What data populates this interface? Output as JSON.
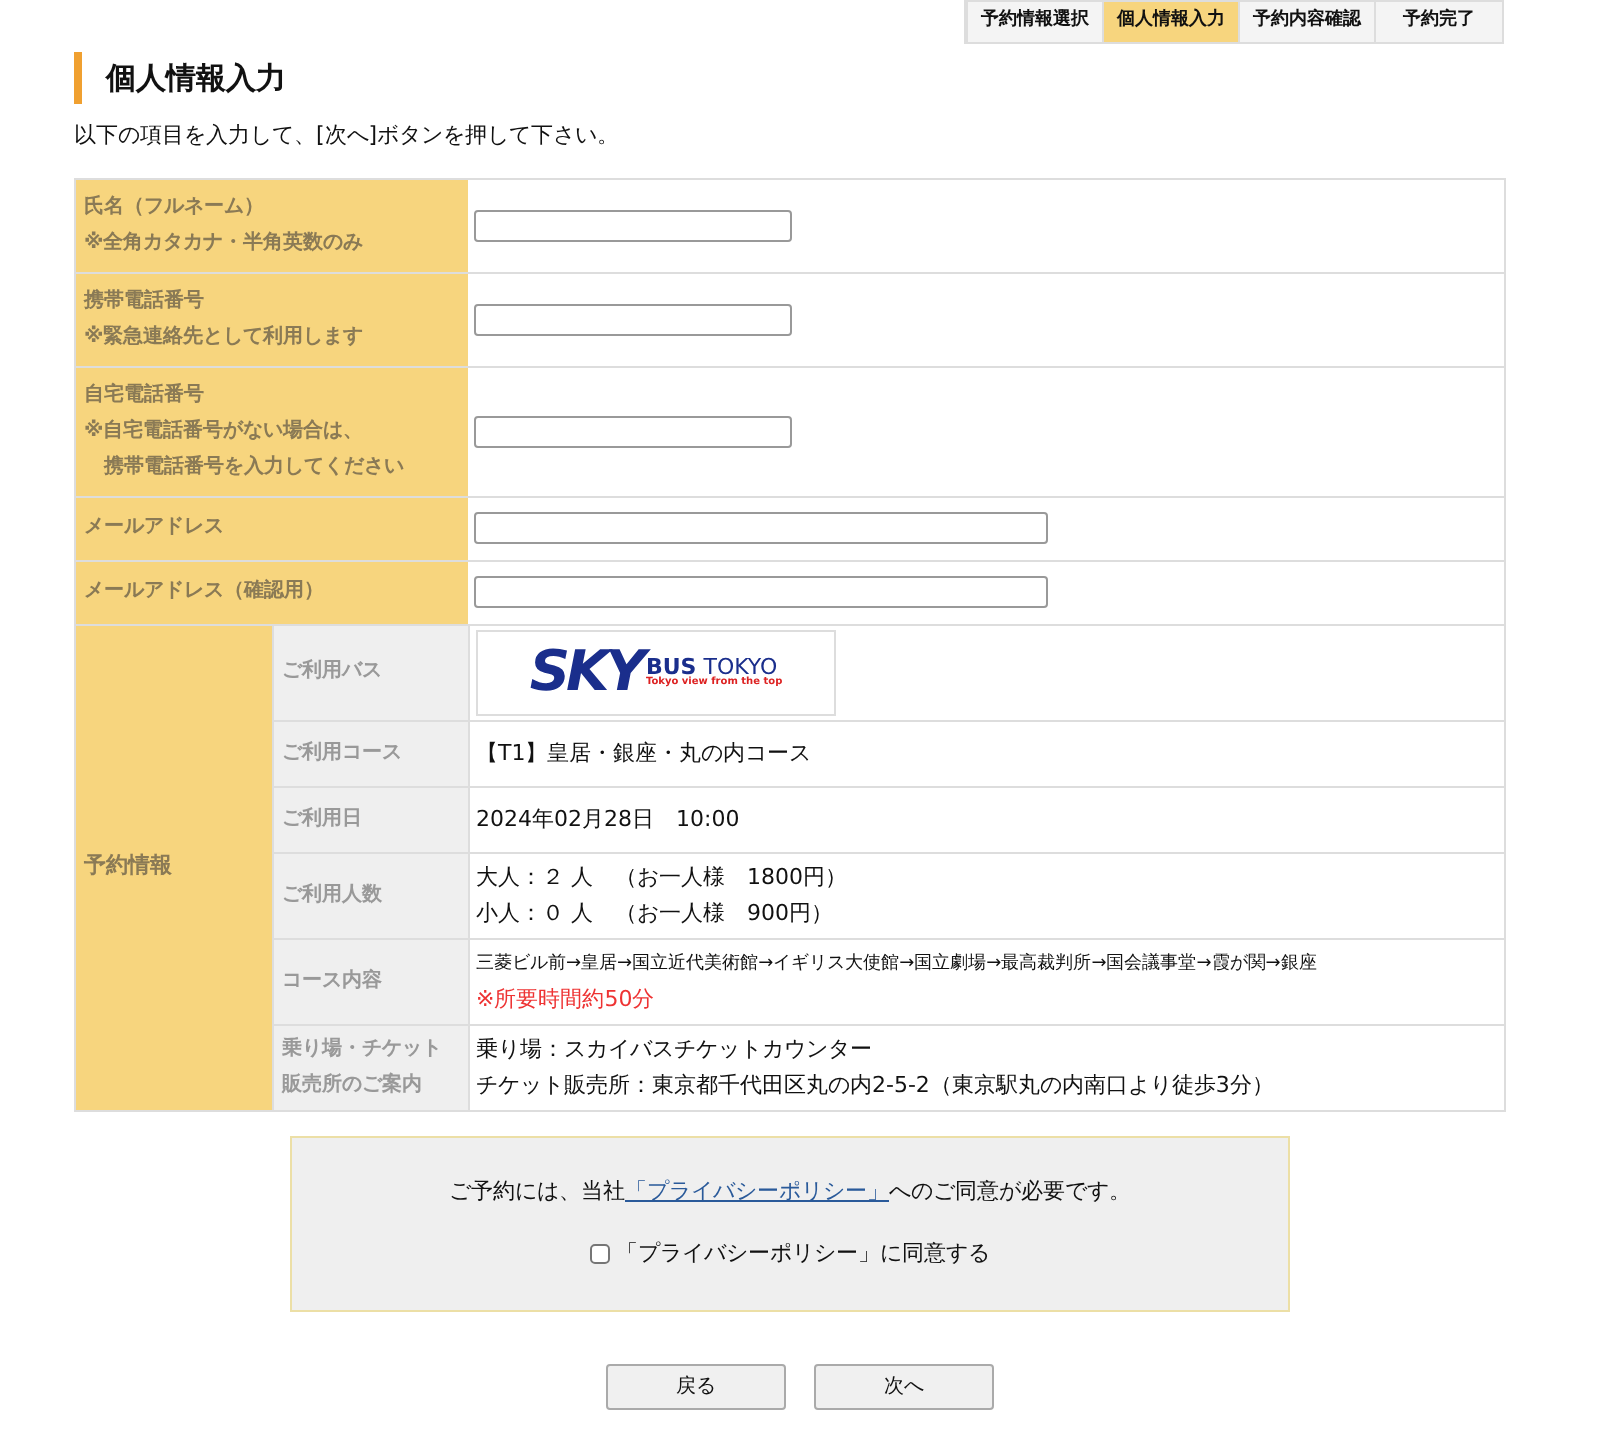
{
  "steps": [
    {
      "label": "予約情報選択",
      "selected": false
    },
    {
      "label": "個人情報入力",
      "selected": true
    },
    {
      "label": "予約内容確認",
      "selected": false
    },
    {
      "label": "予約完了",
      "selected": false
    }
  ],
  "title": "個人情報入力",
  "instruction": "以下の項目を入力して、[次へ]ボタンを押して下さい。",
  "fields": [
    {
      "label": "氏名（フルネーム）",
      "notes": [
        "※全角カタカナ・半角英数のみ"
      ],
      "kind": "short"
    },
    {
      "label": "携帯電話番号",
      "notes": [
        "※緊急連絡先として利用します"
      ],
      "kind": "short"
    },
    {
      "label": "自宅電話番号",
      "notes": [
        "※自宅電話番号がない場合は、",
        "　携帯電話番号を入力してください"
      ],
      "kind": "short"
    },
    {
      "label": "メールアドレス",
      "kind": "long"
    },
    {
      "label": "メールアドレス（確認用）",
      "kind": "long"
    }
  ],
  "reservation": {
    "label": "予約情報",
    "rows": [
      {
        "label": "ご利用バス",
        "kind": "logo",
        "logo": {
          "mark": "SKY",
          "name": "BUS TOKYO",
          "tagline": "Tokyo view from the top"
        }
      },
      {
        "label": "ご利用コース",
        "kind": "text",
        "lines": [
          "【T1】皇居・銀座・丸の内コース"
        ]
      },
      {
        "label": "ご利用日",
        "kind": "text",
        "lines": [
          "2024年02月28日　10:00"
        ]
      },
      {
        "label": "ご利用人数",
        "kind": "text",
        "lines": [
          "大人：２ 人　（お一人様　1800円）",
          "小人：０ 人　（お一人様　900円）"
        ]
      },
      {
        "label": "コース内容",
        "kind": "route",
        "lines": [
          "三菱ビル前→皇居→国立近代美術館→イギリス大使館→国立劇場→最高裁判所→国会議事堂→霞が関→銀座"
        ],
        "warning": "※所要時間約50分"
      },
      {
        "label": "乗り場・チケット販売所のご案内",
        "kind": "text",
        "lines": [
          "乗り場：スカイバスチケットカウンター",
          "チケット販売所：東京都千代田区丸の内2-5-2（東京駅丸の内南口より徒歩3分）"
        ]
      }
    ]
  },
  "agreement": {
    "prefix": "ご予約には、当社",
    "link": "「プライバシーポリシー」",
    "suffix": "へのご同意が必要です。",
    "checkbox": {
      "label": "「プライバシーポリシー」に同意する",
      "checked": false
    }
  },
  "buttons": [
    "戻る",
    "次へ"
  ]
}
